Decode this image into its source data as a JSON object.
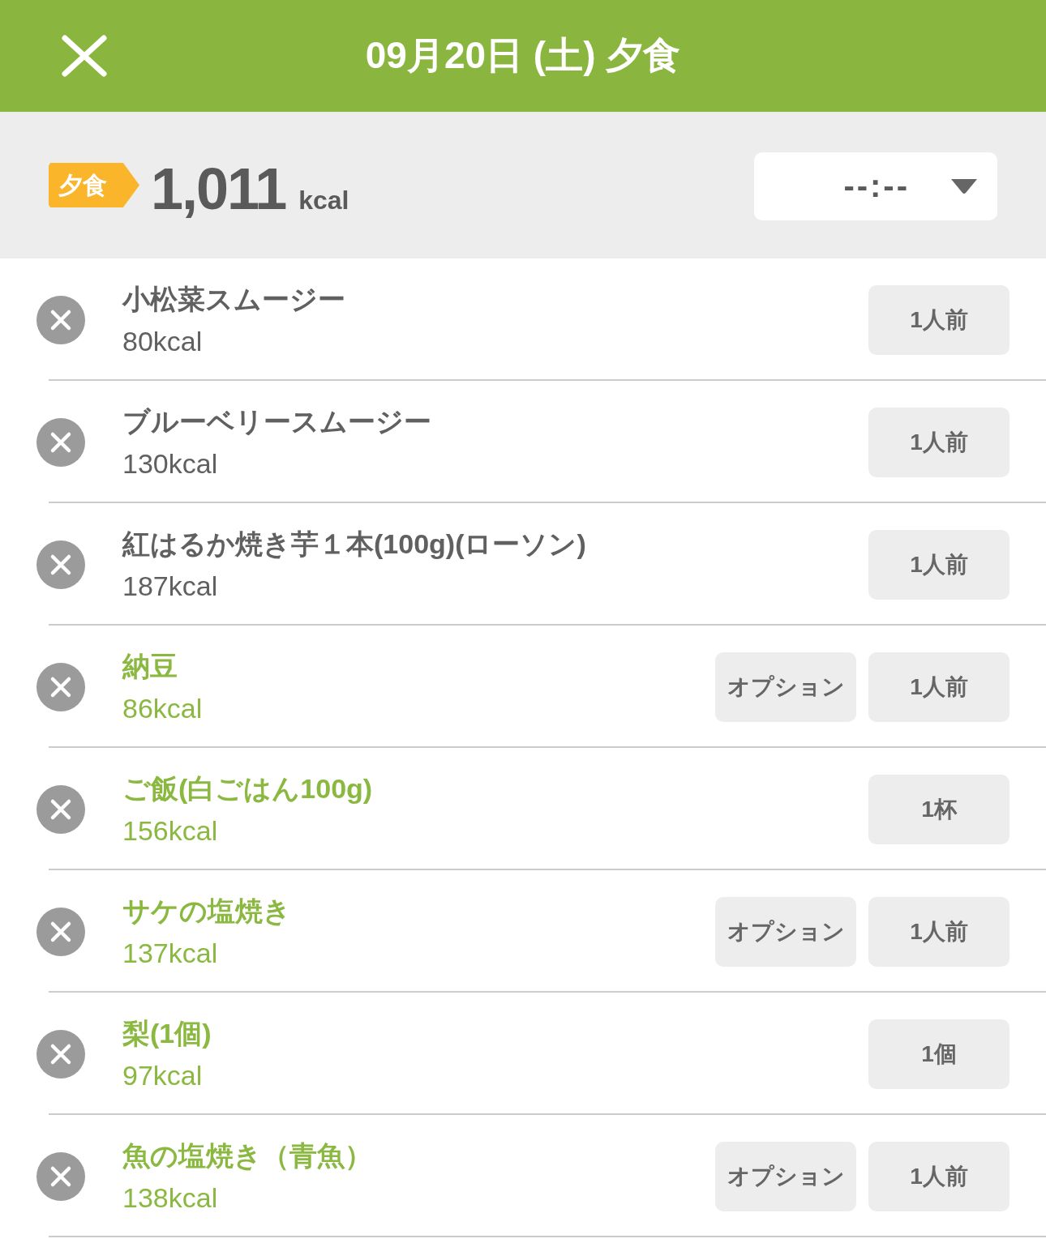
{
  "header": {
    "title": "09月20日 (土) 夕食"
  },
  "summary": {
    "meal_badge": "夕食",
    "total": "1,011",
    "unit": "kcal",
    "time_select": {
      "value": "--:--"
    }
  },
  "items": [
    {
      "name": "小松菜スムージー",
      "calories": "80kcal",
      "color": "#606060",
      "portion": "1人前"
    },
    {
      "name": "ブルーベリースムージー",
      "calories": "130kcal",
      "color": "#606060",
      "portion": "1人前"
    },
    {
      "name": "紅はるか焼き芋１本(100g)(ローソン)",
      "calories": "187kcal",
      "color": "#606060",
      "portion": "1人前"
    },
    {
      "name": "納豆",
      "calories": "86kcal",
      "color": "#8ab840",
      "option": "オプション",
      "portion": "1人前"
    },
    {
      "name": "ご飯(白ごはん100g)",
      "calories": "156kcal",
      "color": "#8ab840",
      "portion": "1杯"
    },
    {
      "name": "サケの塩焼き",
      "calories": "137kcal",
      "color": "#8ab840",
      "option": "オプション",
      "portion": "1人前"
    },
    {
      "name": "梨(1個)",
      "calories": "97kcal",
      "color": "#8ab840",
      "portion": "1個"
    },
    {
      "name": "魚の塩焼き（青魚）",
      "calories": "138kcal",
      "color": "#8ab840",
      "option": "オプション",
      "portion": "1人前"
    }
  ]
}
